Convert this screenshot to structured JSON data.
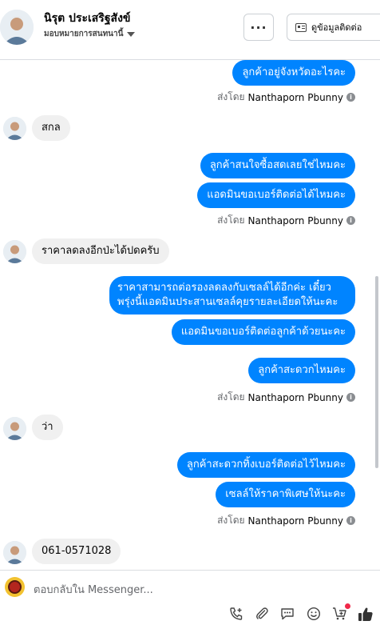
{
  "header": {
    "contact_name": "นิรุต ประเสริฐสังข์",
    "assign_label": "มอบหมายการสนทนานี้",
    "more_label": "···",
    "view_info_label": "ดูข้อมูลติดต่อ"
  },
  "messages": {
    "m1": "ลูกค้าอยู่จังหวัดอะไรคะ",
    "m2": "สกล",
    "m3": "ลูกค้าสนใจซื้อสดเลยใช่ไหมคะ",
    "m4": "แอดมินขอเบอร์ติดต่อได้ไหมคะ",
    "m5": "ราคาลดลงอีกป่ะได้ปดครับ",
    "m6_line1": "ราคาสามารถต่อรองลดลงกับเซลล์ได้อีกค่ะ เดี๋ยว",
    "m6_line2": "พรุ่งนี้แอดมินประสานเซลล์คุยรายละเอียดให้นะคะ",
    "m7": "แอดมินขอเบอร์ติดต่อลูกค้าด้วยนะคะ",
    "m8": "ลูกค้าสะดวกไหมคะ",
    "m9": "ว่า",
    "m10": "ลูกค้าสะดวกทิ้งเบอร์ติดต่อไว้ไหมคะ",
    "m11": "เซลล์ให้ราคาพิเศษให้นะคะ",
    "m12": "061-0571028"
  },
  "sent_by": {
    "prefix": "ส่งโดย",
    "name": "Nanthaporn Pbunny",
    "info_icon": "i"
  },
  "composer": {
    "placeholder": "ตอบกลับใน Messenger...",
    "tools": [
      "call-add-icon",
      "attachment-icon",
      "saved-reply-icon",
      "emoji-icon",
      "cart-add-icon",
      "like-icon"
    ]
  },
  "colors": {
    "outgoing_bubble": "#0084ff",
    "incoming_bubble": "#f0f0f0",
    "notification_dot": "#f02849"
  }
}
